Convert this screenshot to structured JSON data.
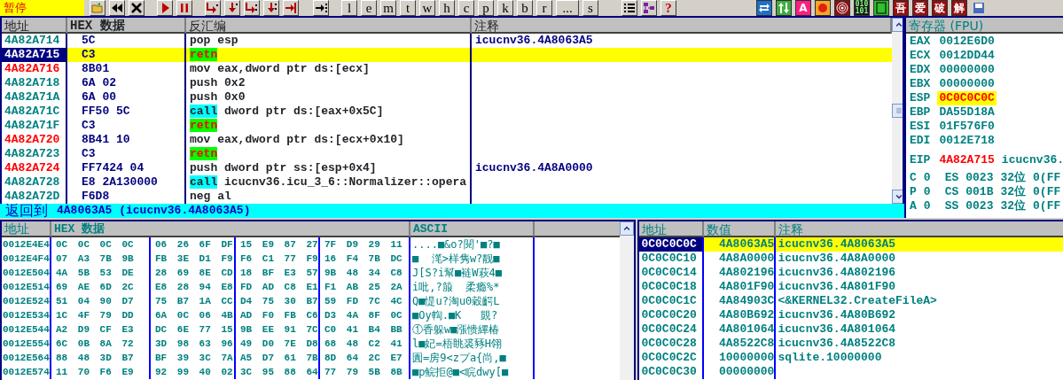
{
  "toolbar": {
    "status": "暂停",
    "groups": [
      [
        {
          "kind": "open"
        },
        {
          "kind": "rewind"
        },
        {
          "kind": "close"
        }
      ],
      [
        {
          "kind": "run"
        },
        {
          "kind": "pause"
        }
      ],
      [
        {
          "kind": "step-into"
        },
        {
          "kind": "step-over"
        },
        {
          "kind": "trace-into"
        },
        {
          "kind": "trace-over"
        },
        {
          "kind": "till-return"
        }
      ],
      [
        {
          "kind": "goto"
        }
      ],
      [
        {
          "kind": "letter",
          "label": "l"
        },
        {
          "kind": "letter",
          "label": "e"
        },
        {
          "kind": "letter",
          "label": "m"
        },
        {
          "kind": "letter",
          "label": "t"
        },
        {
          "kind": "letter",
          "label": "w"
        },
        {
          "kind": "letter",
          "label": "h"
        },
        {
          "kind": "letter",
          "label": "c"
        },
        {
          "kind": "letter",
          "label": "p"
        },
        {
          "kind": "letter",
          "label": "k"
        },
        {
          "kind": "letter",
          "label": "b"
        },
        {
          "kind": "letter",
          "label": "r"
        },
        {
          "kind": "letter",
          "label": "..."
        },
        {
          "kind": "letter",
          "label": "s"
        }
      ],
      [
        {
          "kind": "list"
        },
        {
          "kind": "tree"
        },
        {
          "kind": "help",
          "label": "?"
        }
      ]
    ],
    "plugins": [
      {
        "kind": "swap",
        "color": "#1f6fc9"
      },
      {
        "kind": "updown",
        "color": "#3cae3c"
      },
      {
        "kind": "text",
        "label": "A",
        "color": "#ff1e82"
      },
      {
        "kind": "dot",
        "color": "#f5a623"
      },
      {
        "kind": "target",
        "color": "#8c1010"
      },
      {
        "kind": "binary",
        "label": "010 101",
        "color": "#1a1a1a"
      },
      {
        "kind": "panel",
        "color": "#2fbf2f"
      },
      {
        "kind": "text",
        "label": "吾",
        "color": "#9c0e0e"
      },
      {
        "kind": "text",
        "label": "爱",
        "color": "#9c0e0e"
      },
      {
        "kind": "text",
        "label": "破",
        "color": "#9c0e0e"
      },
      {
        "kind": "text",
        "label": "解",
        "color": "#9c0e0e"
      },
      {
        "kind": "disk",
        "color": "#4a6cc0"
      }
    ]
  },
  "disassembly": {
    "columns": [
      "地址",
      "HEX 数据",
      "反汇编",
      "注释"
    ],
    "rows": [
      {
        "address": "4A82A714",
        "hex": "5C",
        "mnemonic": "pop",
        "operands": "esp",
        "kind": "plain",
        "comment": "icucnv36.4A8063A5",
        "jump_target": false,
        "selected": false,
        "current": false
      },
      {
        "address": "4A82A715",
        "hex": "C3",
        "mnemonic": "retn",
        "kind": "ret",
        "jump_target": false,
        "selected": true,
        "current": true
      },
      {
        "address": "4A82A716",
        "hex": "8B01",
        "mnemonic": "mov",
        "operands": "eax,dword ptr ds:[ecx]",
        "kind": "plain",
        "jump_target": true,
        "selected": false,
        "current": false
      },
      {
        "address": "4A82A718",
        "hex": "6A 02",
        "mnemonic": "push",
        "operands": "0x2",
        "kind": "plain",
        "jump_target": false,
        "selected": false,
        "current": false
      },
      {
        "address": "4A82A71A",
        "hex": "6A 00",
        "mnemonic": "push",
        "operands": "0x0",
        "kind": "plain",
        "jump_target": false,
        "selected": false,
        "current": false
      },
      {
        "address": "4A82A71C",
        "hex": "FF50 5C",
        "mnemonic": "call",
        "operands": "dword ptr ds:[eax+0x5C]",
        "kind": "call",
        "jump_target": false,
        "selected": false,
        "current": false
      },
      {
        "address": "4A82A71F",
        "hex": "C3",
        "mnemonic": "retn",
        "kind": "ret",
        "jump_target": false,
        "selected": false,
        "current": false
      },
      {
        "address": "4A82A720",
        "hex": "8B41 10",
        "mnemonic": "mov",
        "operands": "eax,dword ptr ds:[ecx+0x10]",
        "kind": "plain",
        "jump_target": true,
        "selected": false,
        "current": false
      },
      {
        "address": "4A82A723",
        "hex": "C3",
        "mnemonic": "retn",
        "kind": "ret",
        "jump_target": false,
        "selected": false,
        "current": false
      },
      {
        "address": "4A82A724",
        "hex": "FF7424 04",
        "mnemonic": "push",
        "operands": "dword ptr ss:[esp+0x4]",
        "kind": "plain",
        "comment": "icucnv36.4A8A0000",
        "jump_target": true,
        "selected": false,
        "current": false
      },
      {
        "address": "4A82A728",
        "hex": "E8 2A130000",
        "mnemonic": "call",
        "operands": "icucnv36.icu_3_6::Normalizer::opera",
        "kind": "call",
        "jump_target": false,
        "selected": false,
        "current": false
      },
      {
        "address": "4A82A72D",
        "hex": "F6D8",
        "mnemonic": "neg",
        "operands": "al",
        "kind": "plain",
        "jump_target": false,
        "selected": false,
        "current": false
      }
    ]
  },
  "registers": {
    "title": "寄存器 (FPU)",
    "items": [
      {
        "name": "EAX",
        "value": "0012E6D0",
        "changed": false
      },
      {
        "name": "ECX",
        "value": "0012DD44",
        "changed": false
      },
      {
        "name": "EDX",
        "value": "00000000",
        "changed": false
      },
      {
        "name": "EBX",
        "value": "00000000",
        "changed": false
      },
      {
        "name": "ESP",
        "value": "0C0C0C0C",
        "changed": true
      },
      {
        "name": "EBP",
        "value": "DA55D18A",
        "changed": false
      },
      {
        "name": "ESI",
        "value": "01F576F0",
        "changed": false
      },
      {
        "name": "EDI",
        "value": "0012E718",
        "changed": false
      }
    ],
    "eip": {
      "name": "EIP",
      "value": "4A82A715",
      "comment": "icucnv36."
    },
    "flags": [
      {
        "flag": "C",
        "value": "0",
        "segment": "ES",
        "selector": "0023",
        "bits": "32位",
        "limit": "0(FF"
      },
      {
        "flag": "P",
        "value": "0",
        "segment": "CS",
        "selector": "001B",
        "bits": "32位",
        "limit": "0(FF"
      },
      {
        "flag": "A",
        "value": "0",
        "segment": "SS",
        "selector": "0023",
        "bits": "32位",
        "limit": "0(FF"
      }
    ]
  },
  "info_bar": {
    "label": "返回到",
    "text": "4A8063A5 (icucnv36.4A8063A5)"
  },
  "dump": {
    "columns": [
      "地址",
      "HEX 数据",
      "ASCII"
    ],
    "rows": [
      {
        "address": "0012E4E4",
        "hex": [
          "0C 0C 0C 0C",
          "06 26 6F DF",
          "15 E9 87 27",
          "7F D9 29 11"
        ],
        "ascii": "....■&o?閱'■?■"
      },
      {
        "address": "0012E4F4",
        "hex": [
          "07 A3 7B 9B",
          "FB 3E D1 F9",
          "F6 C1 77 F9",
          "16 F4 7B DC"
        ],
        "ascii": "■  滗>样隽w?靓■"
      },
      {
        "address": "0012E504",
        "hex": [
          "4A 5B 53 DE",
          "28 69 8E CD",
          "18 BF E3 57",
          "9B 48 34 C8"
        ],
        "ascii": "J[S?i幫■裢W萩4■"
      },
      {
        "address": "0012E514",
        "hex": [
          "69 AE 6D 2C",
          "E8 28 94 E8",
          "FD AD C8 E1",
          "F1 AB 25 2A"
        ],
        "ascii": "i吡,?箙  柔瘾%*"
      },
      {
        "address": "0012E524",
        "hex": [
          "51 04 90 D7",
          "75 B7 1A CC",
          "D4 75 30 B7",
          "59 FD 7C 4C"
        ],
        "ascii": "Q■惿u?淘u0穀齶L"
      },
      {
        "address": "0012E534",
        "hex": [
          "1C 4F 79 DD",
          "6A 0C 06 4B",
          "AD F0 FB C6",
          "D3 4A 8F 0C"
        ],
        "ascii": "■Oy輷.■K   覬?"
      },
      {
        "address": "0012E544",
        "hex": [
          "A2 D9 CF E3",
          "DC 6E 77 15",
          "9B EE 91 7C",
          "C0 41 B4 BB"
        ],
        "ascii": "①香躲w■漲愦縪椿"
      },
      {
        "address": "0012E554",
        "hex": [
          "6C 0B 8A 72",
          "3D 98 63 96",
          "49 D0 7E D8",
          "68 48 C2 41"
        ],
        "ascii": "l■妃=梧眺裘豩H翎"
      },
      {
        "address": "0012E564",
        "hex": [
          "88 48 3D B7",
          "BF 39 3C 7A",
          "A5 D7 61 7B",
          "8D 64 2C E7"
        ],
        "ascii": "圚=房9<zプa{尚,■"
      },
      {
        "address": "0012E574",
        "hex": [
          "11 70 F6 E9",
          "92 99 40 02",
          "3C 95 88 64",
          "77 79 5B 8B"
        ],
        "ascii": "■p鲩拒@■<睆dwy[■"
      }
    ]
  },
  "stack": {
    "columns": [
      "地址",
      "数值",
      "注释"
    ],
    "rows": [
      {
        "address": "0C0C0C0C",
        "value": "4A8063A5",
        "comment": "icucnv36.4A8063A5",
        "selected": true
      },
      {
        "address": "0C0C0C10",
        "value": "4A8A0000",
        "comment": "icucnv36.4A8A0000",
        "selected": false
      },
      {
        "address": "0C0C0C14",
        "value": "4A802196",
        "comment": "icucnv36.4A802196",
        "selected": false
      },
      {
        "address": "0C0C0C18",
        "value": "4A801F90",
        "comment": "icucnv36.4A801F90",
        "selected": false
      },
      {
        "address": "0C0C0C1C",
        "value": "4A84903C",
        "comment": "<&KERNEL32.CreateFileA>",
        "selected": false
      },
      {
        "address": "0C0C0C20",
        "value": "4A80B692",
        "comment": "icucnv36.4A80B692",
        "selected": false
      },
      {
        "address": "0C0C0C24",
        "value": "4A801064",
        "comment": "icucnv36.4A801064",
        "selected": false
      },
      {
        "address": "0C0C0C28",
        "value": "4A8522C8",
        "comment": "icucnv36.4A8522C8",
        "selected": false
      },
      {
        "address": "0C0C0C2C",
        "value": "10000000",
        "comment": "sqlite.10000000",
        "selected": false
      },
      {
        "address": "0C0C0C30",
        "value": "00000000",
        "selected": false
      }
    ]
  }
}
